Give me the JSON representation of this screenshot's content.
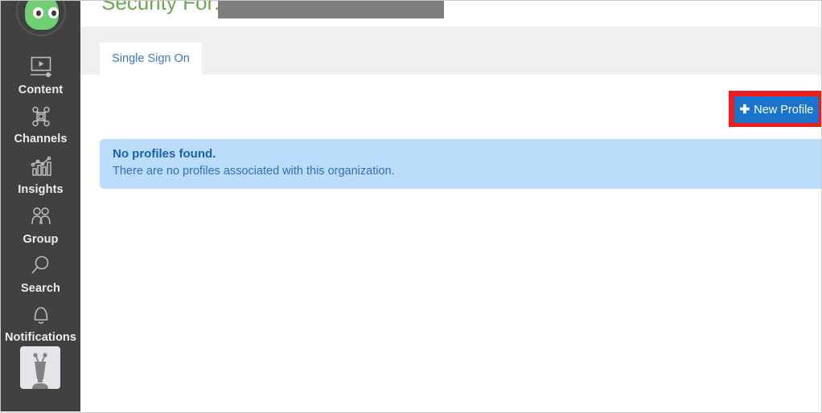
{
  "sidebar": {
    "logo": {
      "icon": "android-head-logo",
      "color": "#6fcf73"
    },
    "items": [
      {
        "id": "content",
        "label": "Content",
        "icon": "video-player-icon"
      },
      {
        "id": "channels",
        "label": "Channels",
        "icon": "network-nodes-icon"
      },
      {
        "id": "insights",
        "label": "Insights",
        "icon": "bar-chart-trend-icon"
      },
      {
        "id": "group",
        "label": "Group",
        "icon": "people-group-icon"
      },
      {
        "id": "search",
        "label": "Search",
        "icon": "magnifier-icon"
      },
      {
        "id": "notifications",
        "label": "Notifications",
        "icon": "bell-icon"
      }
    ],
    "avatar": {
      "icon": "robot-avatar-icon"
    }
  },
  "header": {
    "title": "Security For:",
    "title_color": "#6aaa4f",
    "redaction": {
      "name": "redacted-organization-name",
      "color": "#7e7e7e"
    }
  },
  "tabs": [
    {
      "id": "single-sign-on",
      "label": "Single Sign On",
      "active": true
    }
  ],
  "toolbar": {
    "new_profile_label": "New Profile",
    "new_profile_icon": "plus-icon",
    "new_profile_glyph": "✚",
    "button_color": "#1874cd",
    "highlight_color": "#ee1c1c"
  },
  "alert": {
    "title": "No profiles found.",
    "message": "There are no profiles associated with this organization.",
    "background": "#bcdcfb",
    "text_color": "#2d6fc4"
  }
}
